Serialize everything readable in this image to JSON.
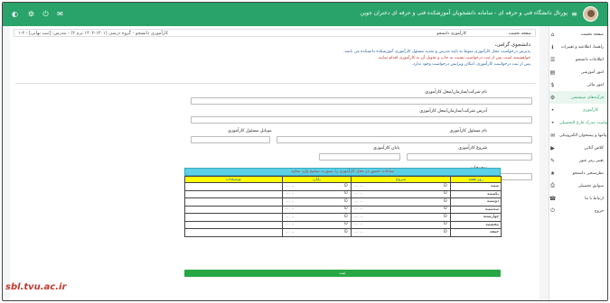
{
  "topbar": {
    "title": "پورتال دانشگاه فنی و حرفه ای - سامانه دانشجویان آموزشکده فنی و حرفه ای دختران جوین"
  },
  "breadcrumb": {
    "home": "صفحه نخست",
    "course": "کارآموزی دانشجو",
    "info": "کارآموزی دانشجو - گروه درسی (۱۴۰۱-۱۴۰۲ ترم ۲) - مدرس: [ثبت نهایی] - ۲-۱"
  },
  "sidebar": {
    "items": [
      {
        "label": "صفحه نخست",
        "icon": "⌂"
      },
      {
        "label": "راهنما، اطلاعیه و تغییرات",
        "icon": "ℹ"
      },
      {
        "label": "اطلاعات دانشجو",
        "icon": "☰"
      },
      {
        "label": "امور آموزشی",
        "icon": "▤"
      },
      {
        "label": "امور مالی",
        "icon": "$"
      },
      {
        "label": "فرآیندهای سیستمی",
        "icon": "⚙"
      },
      {
        "label": "کارآموزی",
        "icon": "•",
        "sub": true
      },
      {
        "label": "درخواست مدرک فارغ التحصیلی",
        "icon": "•",
        "sub": true
      },
      {
        "label": "پیامها و پیشخوان الکترونیکی",
        "icon": "✉"
      },
      {
        "label": "کلاس آنلاین",
        "icon": "▶"
      },
      {
        "label": "تغییر رمز عبور",
        "icon": "✎"
      },
      {
        "label": "نظرسنجی دانشجو",
        "icon": "★"
      },
      {
        "label": "سوابق تحصیلی",
        "icon": "⎙"
      },
      {
        "label": "ارتباط با ما",
        "icon": "☎"
      },
      {
        "label": "خروج",
        "icon": "⏻"
      }
    ]
  },
  "notice": {
    "greeting": "دانشجوی گرامی،",
    "line1": "پذیرش درخواست محل کارآموزی منوط به تایید مدرس و تمدید مسئول کارآموزی آموزشکده دانشکده می باشد.",
    "line2": "خواهشمند است پس از ثبت درخواست نسبت به چاپ و تحویل آن به کارآموزی اقدام نمایید.",
    "line3": "پس از ثبت درخواست کارآموزی، امکان ویرایش درخواست وجود ندارد."
  },
  "form": {
    "company_name_label": "نام شرکت/سازمان/محل کارآموزی",
    "address_label": "آدرس شرکت/سازمان/محل کارآموزی",
    "supervisor_label": "نام مسئول کارآموزی",
    "supervisor_mobile_label": "موبایل مسئول کارآموزی",
    "start_date_label": "شروع کارآموزی",
    "end_date_label": "پایان کارآموزی",
    "description_label": "توضیحات"
  },
  "schedule": {
    "caption": "ساعات حضور در محل کارآموزی را بصورت صحیح وارد نمایید",
    "headers": {
      "day": "روز هفته",
      "start": "شروع",
      "end": "پایان",
      "notes": "توضیحات"
    },
    "time_placeholder": "-- : --",
    "days": [
      "شنبه",
      "یکشنبه",
      "دوشنبه",
      "سه‌شنبه",
      "چهارشنبه",
      "پنجشنبه",
      "جمعه"
    ]
  },
  "submit_label": "ثبت",
  "watermark": "sbl.tvu.ac.ir",
  "colors": {
    "primary_green": "#2aa36a",
    "caption_cyan": "#5bd0e6",
    "header_yellow": "#ffff00",
    "submit_green": "#28a745",
    "watermark_red": "#c0392b"
  }
}
